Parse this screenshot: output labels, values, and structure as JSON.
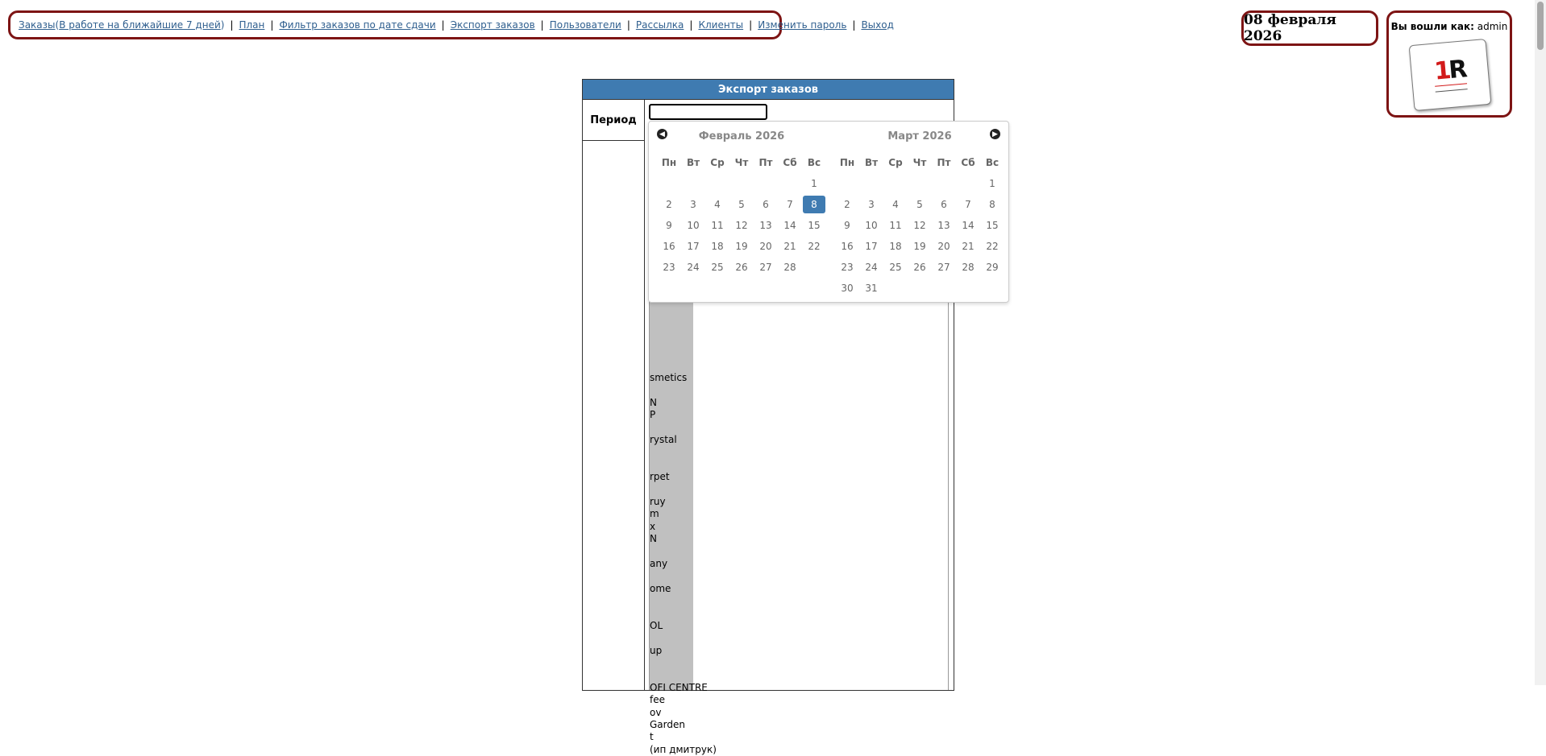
{
  "nav": {
    "orders": "Заказы",
    "orders_week": "В работе на ближайшие 7 дней",
    "plan": "План",
    "filter": "Фильтр заказов по дате сдачи",
    "export": "Экспорт заказов",
    "users": "Пользователи",
    "mailing": "Рассылка",
    "clients": "Клиенты",
    "change_password": "Изменить пароль",
    "logout": "Выход",
    "separator": "|",
    "paren_open": "(",
    "paren_close": ")"
  },
  "date_display": "08 февраля 2026",
  "user": {
    "prefix": "Вы вошли как:",
    "name": "admin"
  },
  "logo": {
    "mark_one": "1",
    "mark_r": "R"
  },
  "export": {
    "title": "Экспорт заказов",
    "period_label": "Период",
    "period_value": ""
  },
  "list_items": [
    "smetics",
    "",
    "N",
    "P",
    "",
    "rystal",
    "",
    "",
    "rpet",
    "",
    "ruy",
    "m",
    "x",
    "N",
    "",
    "any",
    "",
    "ome",
    "",
    "",
    "OL",
    "",
    "up",
    "",
    "",
    "OFI CENTRE",
    "fee",
    "ov",
    "Garden",
    "t",
    "(ип дмитрук)"
  ],
  "calendar": {
    "prev_icon": "◀",
    "next_icon": "▶",
    "weekdays": [
      "Пн",
      "Вт",
      "Ср",
      "Чт",
      "Пт",
      "Сб",
      "Вс"
    ],
    "months": [
      {
        "title": "Февраль 2026",
        "weeks": [
          [
            "",
            "",
            "",
            "",
            "",
            "",
            "1"
          ],
          [
            "2",
            "3",
            "4",
            "5",
            "6",
            "7",
            "8"
          ],
          [
            "9",
            "10",
            "11",
            "12",
            "13",
            "14",
            "15"
          ],
          [
            "16",
            "17",
            "18",
            "19",
            "20",
            "21",
            "22"
          ],
          [
            "23",
            "24",
            "25",
            "26",
            "27",
            "28",
            ""
          ]
        ],
        "selected": "8"
      },
      {
        "title": "Март 2026",
        "weeks": [
          [
            "",
            "",
            "",
            "",
            "",
            "",
            "1"
          ],
          [
            "2",
            "3",
            "4",
            "5",
            "6",
            "7",
            "8"
          ],
          [
            "9",
            "10",
            "11",
            "12",
            "13",
            "14",
            "15"
          ],
          [
            "16",
            "17",
            "18",
            "19",
            "20",
            "21",
            "22"
          ],
          [
            "23",
            "24",
            "25",
            "26",
            "27",
            "28",
            "29"
          ],
          [
            "30",
            "31",
            "",
            "",
            "",
            "",
            ""
          ]
        ],
        "selected": ""
      }
    ]
  }
}
